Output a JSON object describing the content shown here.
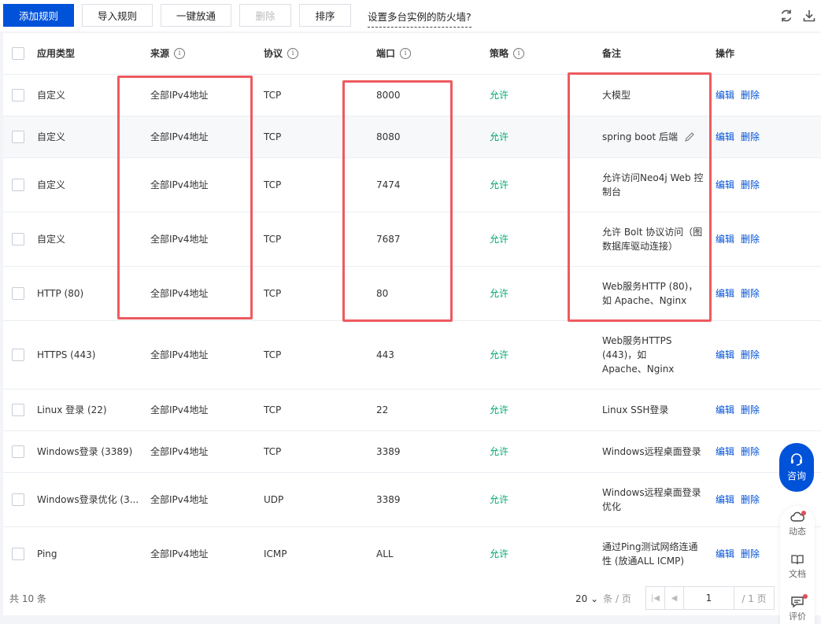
{
  "toolbar": {
    "add_rule": "添加规则",
    "import_rule": "导入规则",
    "one_click_open": "一键放通",
    "delete": "删除",
    "sort": "排序",
    "multi_instance_link": "设置多台实例的防火墙?"
  },
  "columns": {
    "app_type": "应用类型",
    "source": "来源",
    "protocol": "协议",
    "port": "端口",
    "policy": "策略",
    "note": "备注",
    "action": "操作"
  },
  "actions": {
    "edit": "编辑",
    "delete": "删除"
  },
  "rows": [
    {
      "app_type": "自定义",
      "source": "全部IPv4地址",
      "protocol": "TCP",
      "port": "8000",
      "policy": "允许",
      "note": "大模型"
    },
    {
      "app_type": "自定义",
      "source": "全部IPv4地址",
      "protocol": "TCP",
      "port": "8080",
      "policy": "允许",
      "note": "spring boot 后端"
    },
    {
      "app_type": "自定义",
      "source": "全部IPv4地址",
      "protocol": "TCP",
      "port": "7474",
      "policy": "允许",
      "note": "允许访问Neo4j Web 控制台"
    },
    {
      "app_type": "自定义",
      "source": "全部IPv4地址",
      "protocol": "TCP",
      "port": "7687",
      "policy": "允许",
      "note": "允许 Bolt 协议访问（图数据库驱动连接）"
    },
    {
      "app_type": "HTTP (80)",
      "source": "全部IPv4地址",
      "protocol": "TCP",
      "port": "80",
      "policy": "允许",
      "note": "Web服务HTTP (80)，如 Apache、Nginx"
    },
    {
      "app_type": "HTTPS (443)",
      "source": "全部IPv4地址",
      "protocol": "TCP",
      "port": "443",
      "policy": "允许",
      "note": "Web服务HTTPS (443)，如 Apache、Nginx"
    },
    {
      "app_type": "Linux 登录 (22)",
      "source": "全部IPv4地址",
      "protocol": "TCP",
      "port": "22",
      "policy": "允许",
      "note": "Linux SSH登录"
    },
    {
      "app_type": "Windows登录 (3389)",
      "source": "全部IPv4地址",
      "protocol": "TCP",
      "port": "3389",
      "policy": "允许",
      "note": "Windows远程桌面登录"
    },
    {
      "app_type": "Windows登录优化 (3...",
      "source": "全部IPv4地址",
      "protocol": "UDP",
      "port": "3389",
      "policy": "允许",
      "note": "Windows远程桌面登录优化"
    },
    {
      "app_type": "Ping",
      "source": "全部IPv4地址",
      "protocol": "ICMP",
      "port": "ALL",
      "policy": "允许",
      "note": "通过Ping测试网络连通性 (放通ALL ICMP)"
    }
  ],
  "footer": {
    "total": "共 10 条",
    "page_size": "20",
    "page_size_unit": "条 / 页",
    "current_page": "1",
    "total_pages": "/ 1 页"
  },
  "float": {
    "consult": "咨询",
    "dynamic": "动态",
    "docs": "文档",
    "rate": "评价"
  },
  "colors": {
    "primary": "#0052d9",
    "allow": "#00a870",
    "highlight": "#ee5a5f"
  }
}
